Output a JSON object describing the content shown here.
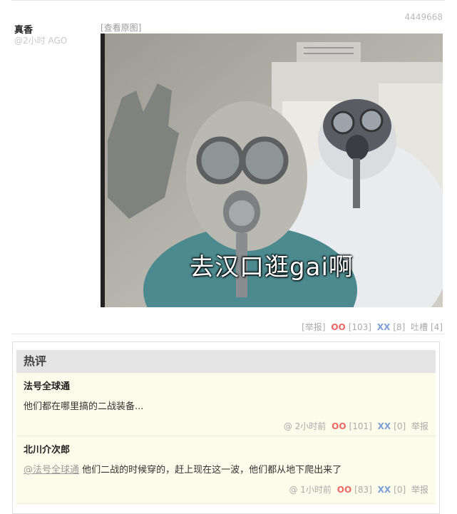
{
  "post": {
    "id": "4449668",
    "author": "真香",
    "time": "@2小时 AGO",
    "view_original": "[查看原图]",
    "image_caption": "去汉口逛gai啊",
    "actions": {
      "report": "[举报]",
      "oo_label": "OO",
      "oo_count": "[103]",
      "xx_label": "XX",
      "xx_count": "[8]",
      "tucao": "吐槽 [4]"
    }
  },
  "hot_comments": {
    "title": "热评",
    "items": [
      {
        "author": "法号全球通",
        "mention": "",
        "text": "他们都在哪里搞的二战装备...",
        "time": "@ 2小时前",
        "oo_label": "OO",
        "oo_count": "[101]",
        "xx_label": "XX",
        "xx_count": "[0]",
        "report": "举报"
      },
      {
        "author": "北川介次郎",
        "mention": "@法号全球通",
        "text": " 他们二战的时候穿的，赶上现在这一波，他们都从地下爬出来了",
        "time": "@ 1小时前",
        "oo_label": "OO",
        "oo_count": "[83]",
        "xx_label": "XX",
        "xx_count": "[0]",
        "report": "举报"
      }
    ]
  },
  "colors": {
    "oo": "#e66666",
    "xx": "#7b9fd6",
    "comment_bg": "#fcfcea"
  }
}
